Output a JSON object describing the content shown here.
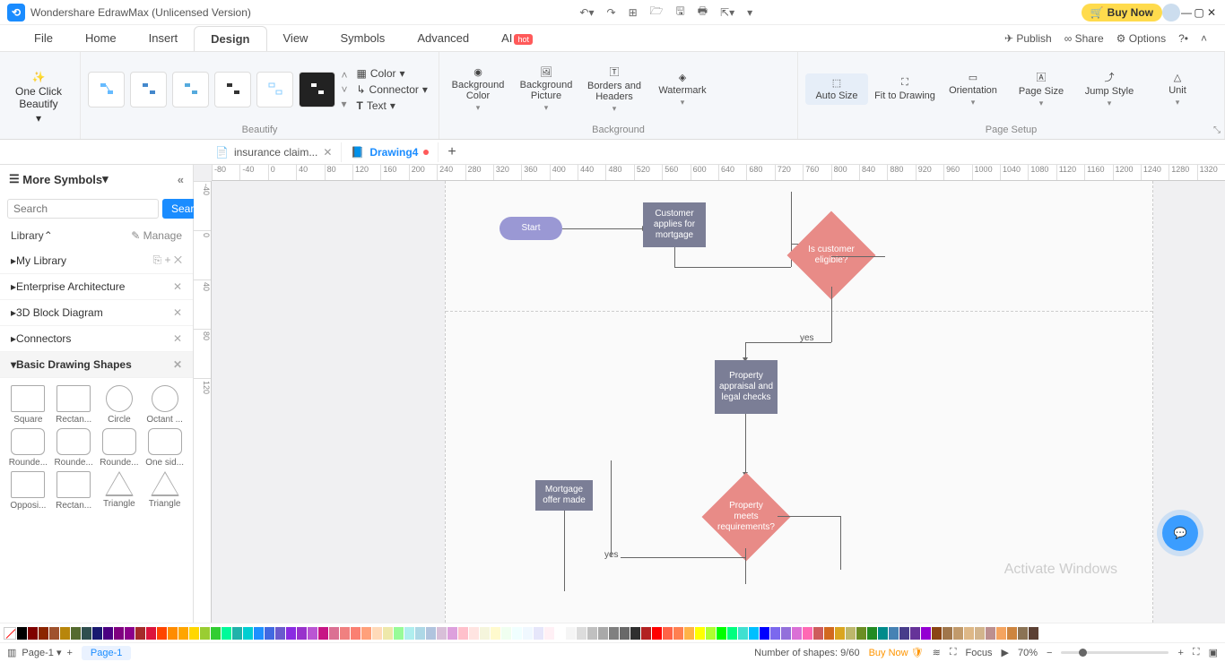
{
  "app": {
    "title": "Wondershare EdrawMax (Unlicensed Version)",
    "buynow": "Buy Now"
  },
  "menu": {
    "items": [
      "File",
      "Home",
      "Insert",
      "Design",
      "View",
      "Symbols",
      "Advanced",
      "AI"
    ],
    "active": "Design",
    "right": {
      "publish": "Publish",
      "share": "Share",
      "options": "Options"
    }
  },
  "ribbon": {
    "oneclick": "One Click Beautify",
    "groups": {
      "beautify": "Beautify",
      "background": "Background",
      "pagesetup": "Page Setup"
    },
    "mini": {
      "color": "Color",
      "connector": "Connector",
      "text": "Text"
    },
    "bg": {
      "bgcolor": "Background Color",
      "bgpic": "Background Picture",
      "borders": "Borders and Headers",
      "watermark": "Watermark"
    },
    "setup": {
      "autosize": "Auto Size",
      "fit": "Fit to Drawing",
      "orient": "Orientation",
      "pagesize": "Page Size",
      "jump": "Jump Style",
      "unit": "Unit"
    }
  },
  "tabs": {
    "t1": "insurance claim...",
    "t2": "Drawing4"
  },
  "sidebar": {
    "more": "More Symbols",
    "search_ph": "Search",
    "search_btn": "Search",
    "library": "Library",
    "manage": "Manage",
    "mylib": "My Library",
    "cats": [
      "Enterprise Architecture",
      "3D Block Diagram",
      "Connectors",
      "Basic Drawing Shapes"
    ],
    "shapes": [
      "Square",
      "Rectan...",
      "Circle",
      "Octant ...",
      "Rounde...",
      "Rounde...",
      "Rounde...",
      "One sid...",
      "Opposi...",
      "Rectan...",
      "Triangle",
      "Triangle"
    ]
  },
  "ruler_h": [
    "-80",
    "-40",
    "0",
    "40",
    "80",
    "120",
    "160",
    "200",
    "240",
    "280",
    "320",
    "360",
    "400",
    "440",
    "480",
    "520",
    "560",
    "600",
    "640",
    "680",
    "720",
    "760",
    "800",
    "840",
    "880",
    "920",
    "960",
    "1000",
    "1040",
    "1080",
    "1120",
    "1160",
    "1200",
    "1240",
    "1280",
    "1320"
  ],
  "ruler_v": [
    "-40",
    "0",
    "40",
    "80",
    "120"
  ],
  "flow": {
    "start": "Start",
    "apply": "Customer applies for mortgage",
    "eligible": "Is customer eligible?",
    "appraisal": "Property appraisal and legal checks",
    "meets": "Property meets requirements?",
    "offer": "Mortgage offer made",
    "yes": "yes"
  },
  "colors": [
    "#000",
    "#7f0000",
    "#8b2500",
    "#a0522d",
    "#b8860b",
    "#556b2f",
    "#2f4f4f",
    "#191970",
    "#4b0082",
    "#800080",
    "#8b008b",
    "#a52a2a",
    "#dc143c",
    "#ff4500",
    "#ff8c00",
    "#ffa500",
    "#ffd700",
    "#9acd32",
    "#32cd32",
    "#00fa9a",
    "#20b2aa",
    "#00ced1",
    "#1e90ff",
    "#4169e1",
    "#6a5acd",
    "#8a2be2",
    "#9932cc",
    "#ba55d3",
    "#c71585",
    "#db7093",
    "#f08080",
    "#fa8072",
    "#ffa07a",
    "#ffdab9",
    "#eee8aa",
    "#98fb98",
    "#afeeee",
    "#add8e6",
    "#b0c4de",
    "#d8bfd8",
    "#dda0dd",
    "#ffc0cb",
    "#ffe4e1",
    "#f5f5dc",
    "#fffacd",
    "#f0fff0",
    "#f0ffff",
    "#f0f8ff",
    "#e6e6fa",
    "#fff0f5",
    "#ffffff",
    "#f5f5f5",
    "#dcdcdc",
    "#c0c0c0",
    "#a9a9a9",
    "#808080",
    "#696969",
    "#2f2f2f",
    "#b22222",
    "#ff0000",
    "#ff6347",
    "#ff7f50",
    "#ffb347",
    "#ffff00",
    "#adff2f",
    "#00ff00",
    "#00ff7f",
    "#40e0d0",
    "#00bfff",
    "#0000ff",
    "#7b68ee",
    "#9370db",
    "#da70d6",
    "#ff69b4",
    "#cd5c5c",
    "#d2691e",
    "#daa520",
    "#bdb76b",
    "#6b8e23",
    "#228b22",
    "#008b8b",
    "#4682b4",
    "#483d8b",
    "#663399",
    "#9400d3",
    "#8b4513",
    "#a0764b",
    "#c19a6b",
    "#deb887",
    "#d2b48c",
    "#bc8f8f",
    "#f4a460",
    "#cd853f",
    "#8b7355",
    "#5c4033"
  ],
  "status": {
    "page": "Page-1",
    "pagetab": "Page-1",
    "shapes": "Number of shapes: 9/60",
    "buynow": "Buy Now",
    "focus": "Focus",
    "zoom": "70%"
  },
  "watermark": "Activate Windows"
}
